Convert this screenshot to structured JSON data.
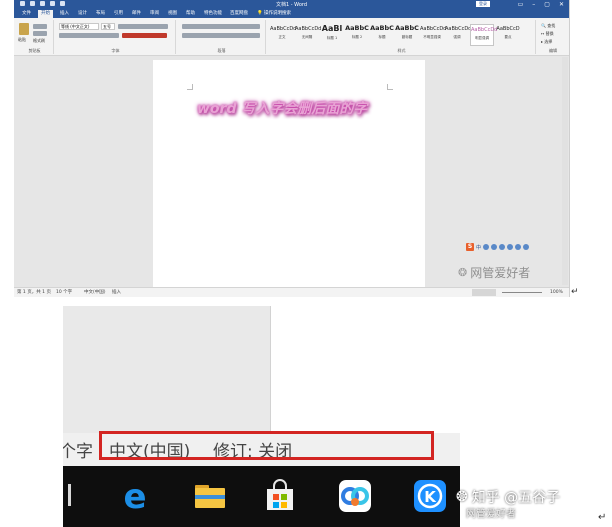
{
  "window": {
    "title": "文档1 - Word",
    "login": "登录",
    "controls": [
      "▭",
      "–",
      "▢",
      "✕"
    ]
  },
  "tabs": [
    "文件",
    "开始",
    "插入",
    "设计",
    "布局",
    "引用",
    "邮件",
    "审阅",
    "视图",
    "帮助",
    "特色功能",
    "百度网盘"
  ],
  "tell_me": "操作说明搜索",
  "ribbon": {
    "groups": [
      "剪贴板",
      "字体",
      "段落",
      "样式",
      "编辑"
    ],
    "font_name": "等线 (中文正文)",
    "font_size": "五号",
    "paste": "粘贴",
    "format_painter": "格式刷",
    "styles": [
      {
        "sample": "AaBbCcDd",
        "name": "正文"
      },
      {
        "sample": "AaBbCcDd",
        "name": "无间隔"
      },
      {
        "sample": "AaBl",
        "name": "标题 1"
      },
      {
        "sample": "AaBbC",
        "name": "标题 2"
      },
      {
        "sample": "AaBbC",
        "name": "标题"
      },
      {
        "sample": "AaBbC",
        "name": "副标题"
      },
      {
        "sample": "AaBbCcDd",
        "name": "不明显强调"
      },
      {
        "sample": "AaBbCcDd",
        "name": "强调"
      },
      {
        "sample": "AaBbCcDd",
        "name": "明显强调"
      },
      {
        "sample": "AaBbCcD",
        "name": "要点"
      }
    ],
    "edit": [
      "查找",
      "替换",
      "选择"
    ]
  },
  "document": {
    "text": "word 写入字会删后面的字"
  },
  "ime_bar": {
    "logo": "S",
    "text": "中"
  },
  "watermark": {
    "top": "网管爱好者",
    "bottom": "知乎 @五谷子",
    "bottom2": "网管爱好者"
  },
  "word_status": {
    "page": "第 1 页，共 1 页",
    "words": "10 个字",
    "language": "中文(中国)",
    "mode": "插入",
    "zoom": "100%"
  },
  "zoom_status": {
    "chars": "个字",
    "language": "中文(中国)",
    "track_changes": "修订: 关闭"
  },
  "colors": {
    "word_blue": "#2b579a",
    "highlight_red": "#d32522",
    "wordart_pink": "#e8a3d4"
  },
  "taskbar_icons": [
    "edge-icon",
    "file-explorer-icon",
    "microsoft-store-icon",
    "baidu-netdisk-icon",
    "kugou-icon"
  ]
}
